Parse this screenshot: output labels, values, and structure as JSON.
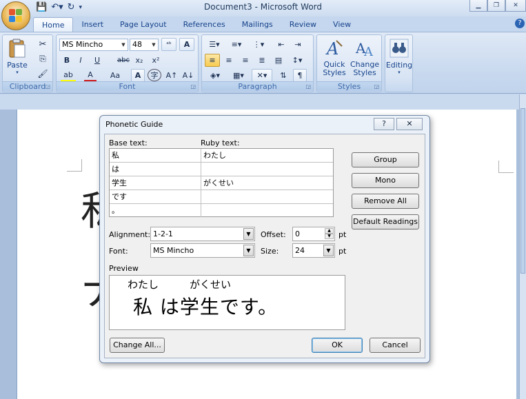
{
  "window": {
    "title": "Document3 - Microsoft Word"
  },
  "tabs": [
    "Home",
    "Insert",
    "Page Layout",
    "References",
    "Mailings",
    "Review",
    "View"
  ],
  "ribbon": {
    "clipboard": {
      "label": "Clipboard",
      "paste": "Paste"
    },
    "font": {
      "label": "Font",
      "name": "MS Mincho",
      "size": "48",
      "buttons": [
        "B",
        "I",
        "U",
        "abc",
        "x₂",
        "x²",
        "A",
        "Aa",
        "A",
        "字",
        "A↑",
        "A↓"
      ]
    },
    "paragraph": {
      "label": "Paragraph"
    },
    "styles": {
      "label": "Styles",
      "quick_styles": "Quick Styles",
      "change_styles": "Change Styles"
    },
    "editing": {
      "label": "Editing"
    }
  },
  "document": {
    "glyph1": "私",
    "glyph2": "ナ"
  },
  "dialog": {
    "title": "Phonetic Guide",
    "help": "?",
    "close": "✕",
    "base_text_label": "Base text:",
    "ruby_text_label": "Ruby text:",
    "rows": [
      {
        "base": "私",
        "ruby": "わたし"
      },
      {
        "base": "は",
        "ruby": ""
      },
      {
        "base": "学生",
        "ruby": "がくせい"
      },
      {
        "base": "です",
        "ruby": ""
      },
      {
        "base": "。",
        "ruby": ""
      }
    ],
    "buttons": {
      "group": "Group",
      "mono": "Mono",
      "remove_all": "Remove All",
      "default_readings": "Default Readings",
      "change_all": "Change All...",
      "ok": "OK",
      "cancel": "Cancel"
    },
    "alignment_label": "Alignment:",
    "alignment_value": "1-2-1",
    "offset_label": "Offset:",
    "offset_value": "0",
    "offset_unit": "pt",
    "font_label": "Font:",
    "font_value": "MS Mincho",
    "size_label": "Size:",
    "size_value": "24",
    "size_unit": "pt",
    "preview_label": "Preview",
    "preview": {
      "ruby1": "わたし",
      "ruby2": "がくせい",
      "base": "私 は学生です。"
    }
  }
}
